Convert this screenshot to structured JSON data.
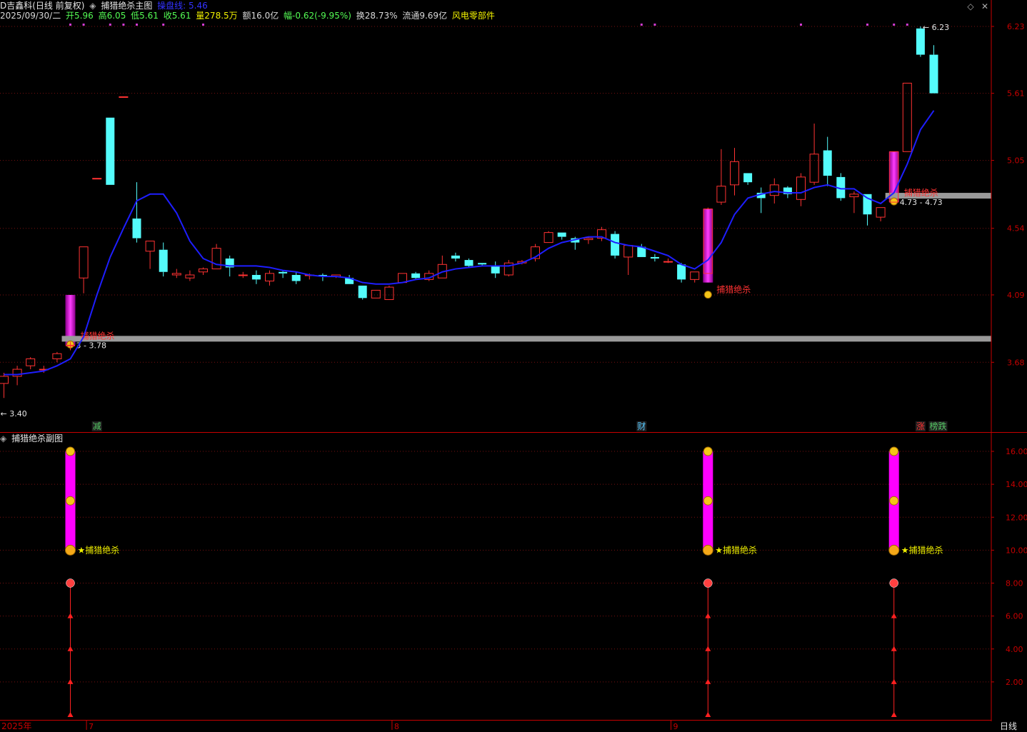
{
  "header": {
    "stock_name": "D吉鑫科(日线 前复权)",
    "indicator_name": "捕猎绝杀主图",
    "ma_label": "操盘线: 5.46",
    "date": "2025/09/30/二",
    "open": "开5.96",
    "high": "高6.05",
    "low": "低5.61",
    "close": "收5.61",
    "volume": "量278.5万",
    "amount": "额16.0亿",
    "change": "幅-0.62(-9.95%)",
    "turnover": "换28.73%",
    "float_cap": "流通9.69亿",
    "concept": "风电零部件"
  },
  "sub_header": {
    "indicator_name": "捕猎绝杀副图"
  },
  "footer": {
    "year": "2025年",
    "period": "日线"
  },
  "colors": {
    "up": "#ff3232",
    "down": "#54fcfc",
    "ma": "#1e1eff",
    "signal": "#ff00ff",
    "grid": "#7a1010",
    "axis": "#c80000",
    "support": "#9a9a9a"
  },
  "chart_data": [
    {
      "type": "candlestick",
      "title": "捕猎绝杀主图",
      "ylim": [
        3.4,
        6.23
      ],
      "yticks": [
        "6.23",
        "5.61",
        "5.05",
        "4.54",
        "4.09",
        "3.68"
      ],
      "x_labels": [
        {
          "i": 6,
          "text": "7"
        },
        {
          "i": 29,
          "text": "8"
        },
        {
          "i": 50,
          "text": "9"
        }
      ],
      "candles": [
        [
          3.56,
          3.62,
          3.48,
          3.6
        ],
        [
          3.6,
          3.66,
          3.55,
          3.64
        ],
        [
          3.66,
          3.71,
          3.64,
          3.7
        ],
        [
          3.64,
          3.66,
          3.62,
          3.64
        ],
        [
          3.7,
          3.74,
          3.68,
          3.73
        ],
        [
          3.78,
          3.8,
          3.75,
          3.78
        ],
        [
          4.2,
          4.41,
          4.1,
          4.41
        ],
        [
          4.91,
          4.91,
          4.91,
          4.91
        ],
        [
          5.4,
          5.4,
          4.86,
          4.86
        ],
        [
          5.58,
          5.58,
          5.58,
          5.58
        ],
        [
          4.61,
          4.88,
          4.44,
          4.47
        ],
        [
          4.38,
          4.45,
          4.26,
          4.45
        ],
        [
          4.39,
          4.44,
          4.21,
          4.24
        ],
        [
          4.22,
          4.26,
          4.2,
          4.23
        ],
        [
          4.2,
          4.25,
          4.18,
          4.22
        ],
        [
          4.24,
          4.27,
          4.22,
          4.26
        ],
        [
          4.26,
          4.43,
          4.26,
          4.4
        ],
        [
          4.33,
          4.35,
          4.21,
          4.27
        ],
        [
          4.22,
          4.24,
          4.2,
          4.22
        ],
        [
          4.22,
          4.25,
          4.16,
          4.19
        ],
        [
          4.18,
          4.25,
          4.15,
          4.23
        ],
        [
          4.24,
          4.25,
          4.2,
          4.23
        ],
        [
          4.22,
          4.24,
          4.16,
          4.18
        ],
        [
          4.22,
          4.23,
          4.19,
          4.22
        ],
        [
          4.22,
          4.23,
          4.18,
          4.21
        ],
        [
          4.21,
          4.22,
          4.2,
          4.22
        ],
        [
          4.2,
          4.22,
          4.16,
          4.16
        ],
        [
          4.15,
          4.15,
          4.06,
          4.07
        ],
        [
          4.07,
          4.12,
          4.07,
          4.12
        ],
        [
          4.06,
          4.15,
          4.06,
          4.14
        ],
        [
          4.17,
          4.23,
          4.17,
          4.23
        ],
        [
          4.23,
          4.24,
          4.19,
          4.2
        ],
        [
          4.19,
          4.25,
          4.18,
          4.23
        ],
        [
          4.2,
          4.35,
          4.2,
          4.29
        ],
        [
          4.35,
          4.37,
          4.31,
          4.33
        ],
        [
          4.32,
          4.33,
          4.27,
          4.28
        ],
        [
          4.3,
          4.3,
          4.28,
          4.29
        ],
        [
          4.28,
          4.31,
          4.2,
          4.23
        ],
        [
          4.22,
          4.32,
          4.21,
          4.3
        ],
        [
          4.3,
          4.32,
          4.29,
          4.31
        ],
        [
          4.33,
          4.43,
          4.31,
          4.41
        ],
        [
          4.44,
          4.52,
          4.44,
          4.51
        ],
        [
          4.51,
          4.51,
          4.46,
          4.48
        ],
        [
          4.47,
          4.48,
          4.39,
          4.44
        ],
        [
          4.46,
          4.48,
          4.43,
          4.47
        ],
        [
          4.47,
          4.55,
          4.45,
          4.53
        ],
        [
          4.5,
          4.52,
          4.33,
          4.35
        ],
        [
          4.34,
          4.42,
          4.22,
          4.42
        ],
        [
          4.41,
          4.43,
          4.34,
          4.34
        ],
        [
          4.34,
          4.36,
          4.31,
          4.33
        ],
        [
          4.31,
          4.33,
          4.3,
          4.31
        ],
        [
          4.29,
          4.3,
          4.17,
          4.19
        ],
        [
          4.19,
          4.24,
          4.17,
          4.24
        ],
        [
          4.23,
          4.69,
          4.23,
          4.68
        ],
        [
          4.73,
          5.14,
          4.71,
          4.85
        ],
        [
          4.86,
          5.15,
          4.78,
          5.04
        ],
        [
          4.95,
          4.95,
          4.86,
          4.88
        ],
        [
          4.8,
          4.84,
          4.65,
          4.76
        ],
        [
          4.78,
          4.91,
          4.72,
          4.86
        ],
        [
          4.84,
          4.85,
          4.76,
          4.79
        ],
        [
          4.75,
          4.95,
          4.7,
          4.92
        ],
        [
          4.88,
          5.35,
          4.86,
          5.1
        ],
        [
          5.13,
          5.24,
          4.85,
          4.93
        ],
        [
          4.92,
          4.95,
          4.74,
          4.76
        ],
        [
          4.77,
          4.81,
          4.65,
          4.79
        ],
        [
          4.79,
          4.79,
          4.56,
          4.64
        ],
        [
          4.62,
          4.69,
          4.59,
          4.69
        ],
        [
          4.73,
          5.12,
          4.73,
          5.12
        ],
        [
          5.12,
          5.7,
          5.12,
          5.7
        ],
        [
          6.21,
          6.23,
          5.94,
          5.96
        ],
        [
          5.96,
          6.05,
          5.61,
          5.61
        ]
      ],
      "ma_label": "操盘线",
      "ma_last_value": 5.46,
      "ma": [
        3.61,
        3.61,
        3.62,
        3.63,
        3.66,
        3.7,
        3.83,
        4.09,
        4.34,
        4.54,
        4.74,
        4.79,
        4.79,
        4.65,
        4.45,
        4.33,
        4.29,
        4.28,
        4.28,
        4.28,
        4.27,
        4.25,
        4.24,
        4.22,
        4.21,
        4.21,
        4.2,
        4.17,
        4.16,
        4.16,
        4.17,
        4.19,
        4.2,
        4.24,
        4.26,
        4.27,
        4.28,
        4.28,
        4.28,
        4.3,
        4.34,
        4.4,
        4.44,
        4.46,
        4.48,
        4.48,
        4.44,
        4.42,
        4.41,
        4.38,
        4.35,
        4.29,
        4.26,
        4.32,
        4.44,
        4.64,
        4.76,
        4.79,
        4.81,
        4.8,
        4.8,
        4.84,
        4.86,
        4.83,
        4.83,
        4.76,
        4.72,
        4.8,
        5.02,
        5.3,
        5.46
      ],
      "signal_bars": [
        {
          "i": 5,
          "from": 3.78,
          "to": 4.09
        },
        {
          "i": 53,
          "from": 4.17,
          "to": 4.68
        },
        {
          "i": 67,
          "from": 4.73,
          "to": 5.12
        }
      ],
      "signal_label": "捕猎绝杀",
      "support_lines": [
        {
          "from": 5,
          "price": 3.78,
          "label": "3 - 3.78"
        },
        {
          "from": 67,
          "price": 4.73,
          "label": "4.73 - 4.73"
        }
      ],
      "extremes": [
        {
          "i": 69,
          "text": "6.23"
        },
        {
          "i": 0,
          "text": "3.40"
        }
      ],
      "event_tags": [
        {
          "i": 7,
          "text": "减",
          "color": "#54c864"
        },
        {
          "i": 48,
          "text": "财",
          "color": "#54c8ff"
        },
        {
          "i": 69,
          "text": "涨",
          "color": "#ff3232"
        },
        {
          "i": 70,
          "text": "榜跌",
          "color": "#54c864"
        }
      ]
    },
    {
      "type": "bar",
      "title": "捕猎绝杀副图",
      "ylim": [
        0,
        16
      ],
      "yticks": [
        "16.00",
        "14.00",
        "12.00",
        "10.00",
        "8.00",
        "6.00",
        "4.00",
        "2.00"
      ],
      "signal_bars": [
        {
          "i": 5,
          "from": 10,
          "to": 16
        },
        {
          "i": 53,
          "from": 10,
          "to": 16
        },
        {
          "i": 67,
          "from": 10,
          "to": 16
        }
      ],
      "stems": [
        {
          "i": 5,
          "to": 8
        },
        {
          "i": 53,
          "to": 8
        },
        {
          "i": 67,
          "to": 8
        }
      ],
      "label": "捕猎绝杀"
    }
  ]
}
